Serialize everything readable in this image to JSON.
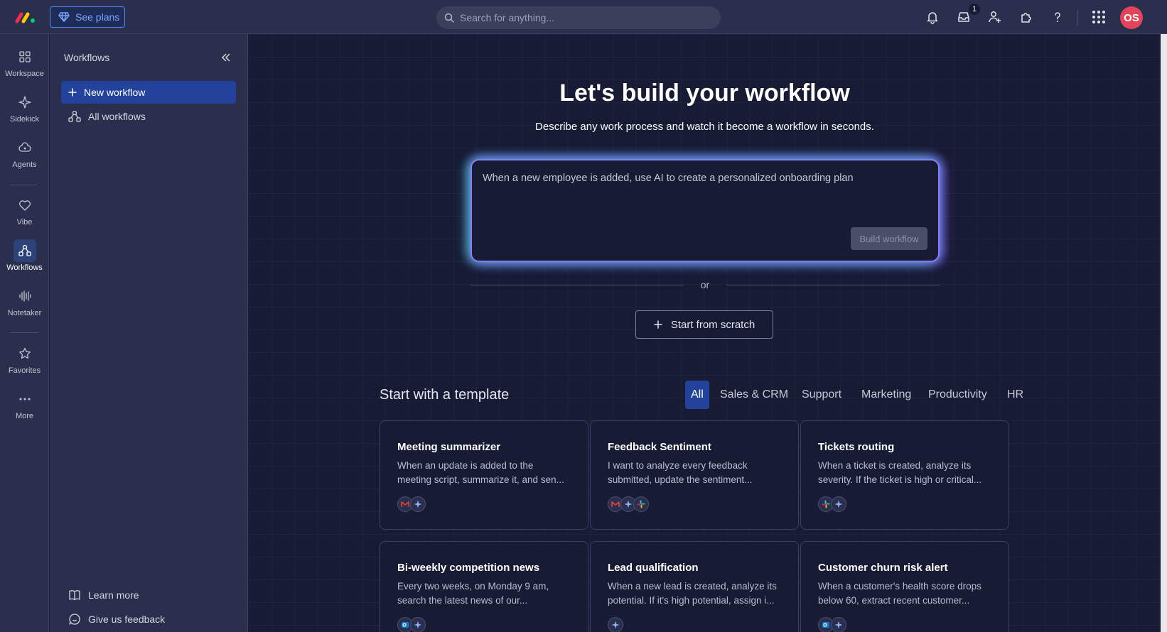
{
  "topbar": {
    "see_plans_label": "See plans",
    "search_placeholder": "Search for anything...",
    "inbox_count": "1",
    "avatar_initials": "OS",
    "icons": [
      "bell-icon",
      "inbox-icon",
      "invite-user-icon",
      "integrations-icon",
      "help-icon",
      "apps-grid-icon"
    ]
  },
  "rail": {
    "items": [
      {
        "label": "Workspace",
        "icon": "workspace-grid-icon"
      },
      {
        "label": "Sidekick",
        "icon": "sparkle-icon"
      },
      {
        "label": "Agents",
        "icon": "agents-icon"
      },
      {
        "label": "Vibe",
        "icon": "heart-icon"
      },
      {
        "label": "Workflows",
        "icon": "workflows-icon",
        "active": true
      },
      {
        "label": "Notetaker",
        "icon": "waveform-icon"
      },
      {
        "label": "Favorites",
        "icon": "star-icon"
      },
      {
        "label": "More",
        "icon": "more-dots-icon"
      }
    ]
  },
  "panel": {
    "title": "Workflows",
    "new_workflow": "New workflow",
    "all_workflows": "All workflows",
    "learn_more": "Learn more",
    "feedback": "Give us feedback"
  },
  "main": {
    "title": "Let's build your workflow",
    "subtitle": "Describe any work process and watch it become a workflow in seconds.",
    "prompt_value": "When a new employee is added, use AI to create a personalized onboarding plan",
    "build_button": "Build workflow",
    "or": "or",
    "scratch_button": "Start from scratch",
    "templates_title": "Start with a template",
    "tabs": [
      "All",
      "Sales & CRM",
      "Support",
      "Marketing",
      "Productivity",
      "HR"
    ],
    "active_tab": "All"
  },
  "templates": [
    {
      "title": "Meeting summarizer",
      "line1": "When an update is added to the",
      "line2": "meeting script, summarize it, and sen...",
      "apps": [
        "gmail-icon",
        "ai-sparkle-icon"
      ]
    },
    {
      "title": "Feedback Sentiment",
      "line1": "I want to analyze every feedback",
      "line2": "submitted, update the sentiment...",
      "apps": [
        "gmail-icon",
        "ai-sparkle-icon",
        "slack-icon"
      ]
    },
    {
      "title": "Tickets routing",
      "line1": "When a ticket is created, analyze its",
      "line2": "severity. If the ticket is high or critical...",
      "apps": [
        "slack-icon",
        "ai-sparkle-icon"
      ]
    },
    {
      "title": "Bi-weekly competition news",
      "line1": "Every two weeks, on Monday 9 am,",
      "line2": "search the latest news of our...",
      "apps": [
        "outlook-icon",
        "ai-sparkle-icon"
      ]
    },
    {
      "title": "Lead qualification",
      "line1": "When a new lead is created, analyze its",
      "line2": "potential. If it's high potential, assign i...",
      "apps": [
        "ai-sparkle-icon"
      ]
    },
    {
      "title": "Customer churn risk alert",
      "line1": "When a customer's health score drops",
      "line2": "below 60, extract recent customer...",
      "apps": [
        "outlook-icon",
        "ai-sparkle-icon"
      ]
    }
  ],
  "colors": {
    "background": "#181b34",
    "surface": "#292f4c",
    "accent": "#23429b",
    "avatar": "#e2445c",
    "glow_left": "#40e0d0",
    "glow_right": "#8c5aff"
  }
}
